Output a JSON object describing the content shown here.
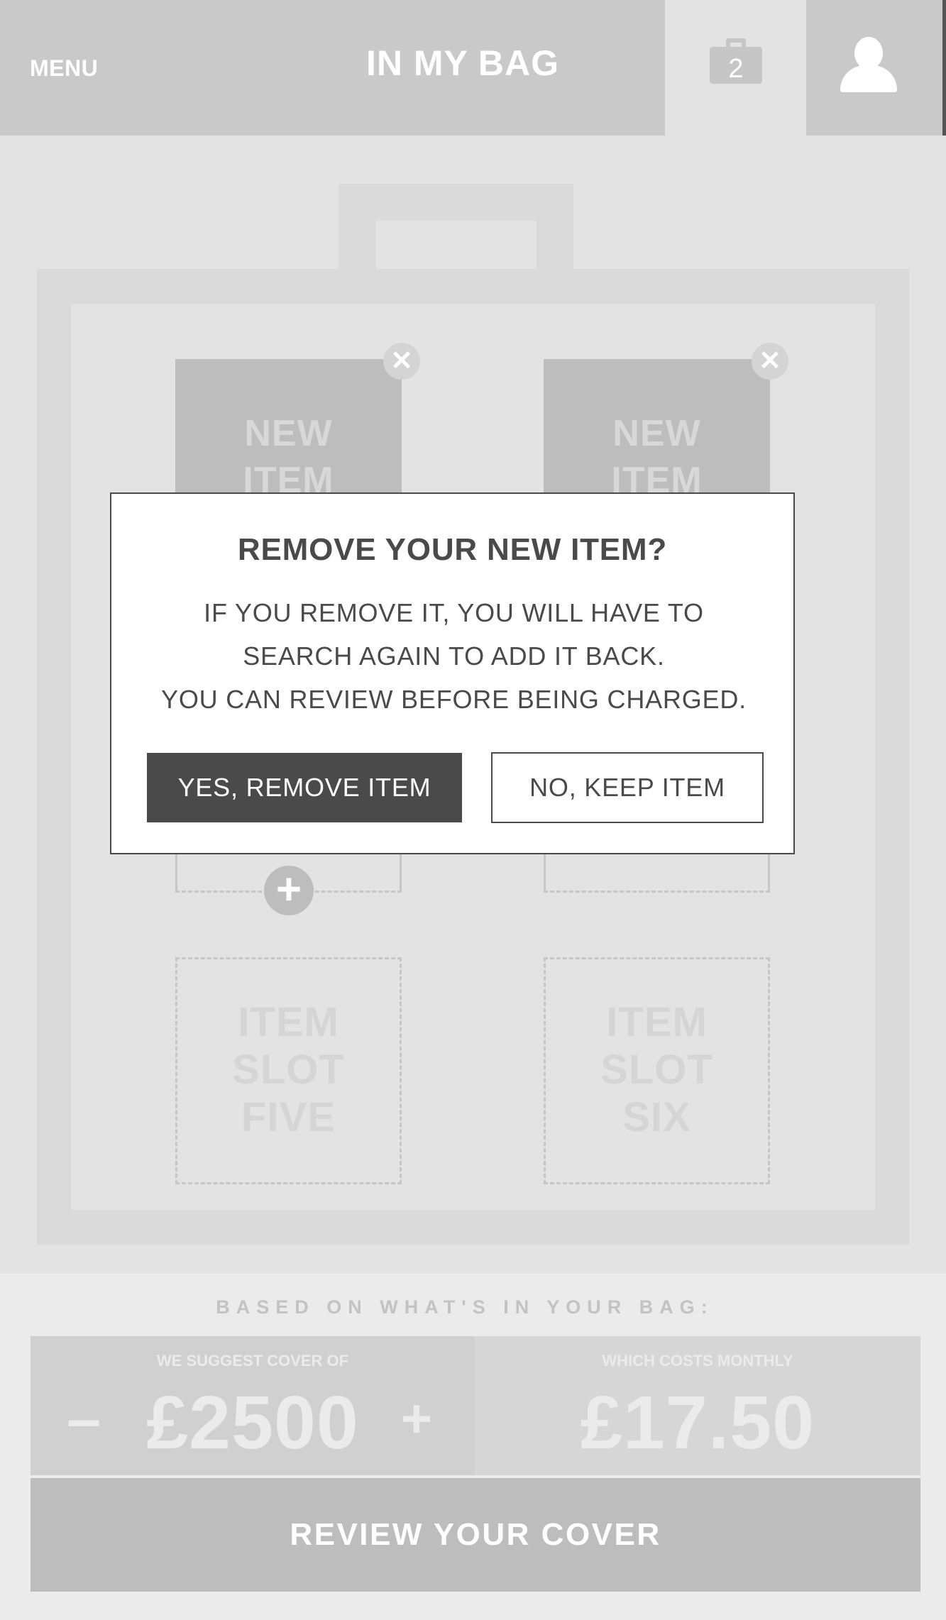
{
  "header": {
    "menu_label": "MENU",
    "title": "IN MY BAG",
    "bag_count": "2",
    "bag_icon": "shopping-bag-icon",
    "user_icon": "user-icon"
  },
  "bag": {
    "items": [
      {
        "label_line1": "NEW",
        "label_line2": "ITEM"
      },
      {
        "label_line1": "NEW",
        "label_line2": "ITEM"
      }
    ],
    "empty_slots": [
      {
        "line1": "ITEM",
        "line2": "SLOT",
        "line3": "FIVE"
      },
      {
        "line1": "ITEM",
        "line2": "SLOT",
        "line3": "SIX"
      }
    ],
    "remove_glyph": "✕",
    "add_glyph": "+"
  },
  "modal": {
    "title": "REMOVE YOUR NEW ITEM?",
    "body_line1": "IF YOU REMOVE IT, YOU WILL HAVE TO",
    "body_line2": "SEARCH AGAIN TO ADD IT BACK.",
    "body_line3": "YOU CAN REVIEW BEFORE BEING CHARGED.",
    "confirm_label": "YES, REMOVE ITEM",
    "cancel_label": "NO, KEEP ITEM"
  },
  "summary": {
    "heading": "BASED ON WHAT'S IN YOUR BAG:",
    "cover_label": "WE SUGGEST COVER OF",
    "cover_amount": "£2500",
    "decrease_glyph": "–",
    "increase_glyph": "+",
    "cost_label": "WHICH COSTS MONTHLY",
    "cost_amount": "£17.50",
    "review_label": "REVIEW YOUR COVER"
  },
  "colors": {
    "modal_text": "#4a4a4a",
    "primary_button": "#4a4a4a",
    "header_background": "#c9c9c9"
  }
}
